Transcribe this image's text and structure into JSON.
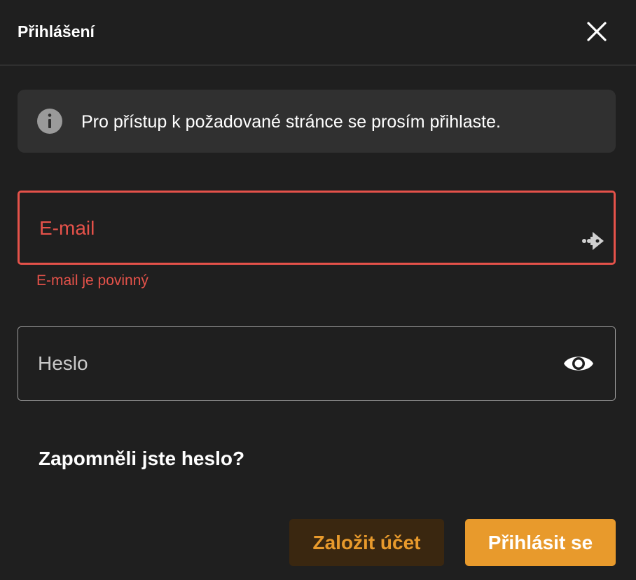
{
  "dialog": {
    "title": "Přihlášení",
    "info_message": "Pro přístup k požadované stránce se prosím přihlaste."
  },
  "form": {
    "email": {
      "label": "E-mail",
      "value": "",
      "error": "E-mail je povinný"
    },
    "password": {
      "label": "Heslo",
      "value": ""
    },
    "forgot_password": "Zapomněli jste heslo?"
  },
  "actions": {
    "create_account": "Založit účet",
    "login": "Přihlásit se"
  },
  "icons": {
    "close": "close-icon",
    "info": "info-icon",
    "autofill": "autofill-key-icon",
    "show_password": "eye-icon"
  },
  "colors": {
    "background": "#1f1f1f",
    "info_box": "#303030",
    "error": "#e5524a",
    "accent": "#e89a2c",
    "secondary_button_bg": "#3a2710"
  }
}
